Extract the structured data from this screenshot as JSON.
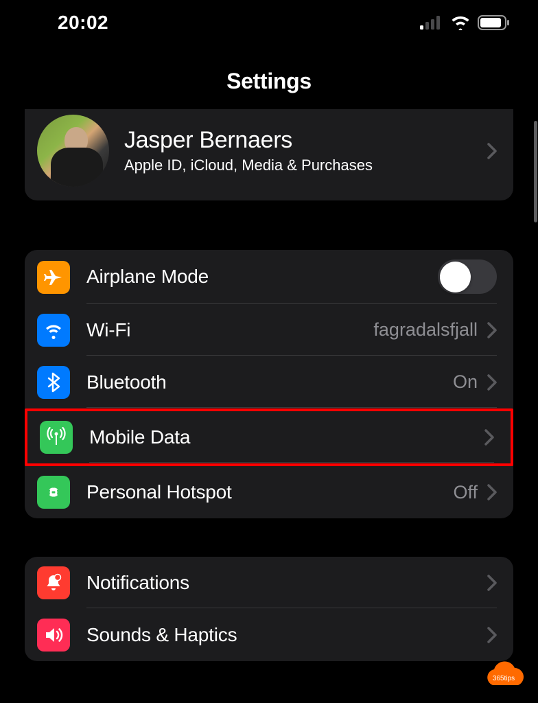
{
  "status": {
    "time": "20:02"
  },
  "header": {
    "title": "Settings"
  },
  "profile": {
    "name": "Jasper Bernaers",
    "subtitle": "Apple ID, iCloud, Media & Purchases"
  },
  "group1": {
    "airplane": {
      "label": "Airplane Mode"
    },
    "wifi": {
      "label": "Wi-Fi",
      "value": "fagradalsfjall"
    },
    "bluetooth": {
      "label": "Bluetooth",
      "value": "On"
    },
    "mobile": {
      "label": "Mobile Data"
    },
    "hotspot": {
      "label": "Personal Hotspot",
      "value": "Off"
    }
  },
  "group2": {
    "notifications": {
      "label": "Notifications"
    },
    "sounds": {
      "label": "Sounds & Haptics"
    }
  },
  "badge": {
    "text": "365tips"
  }
}
